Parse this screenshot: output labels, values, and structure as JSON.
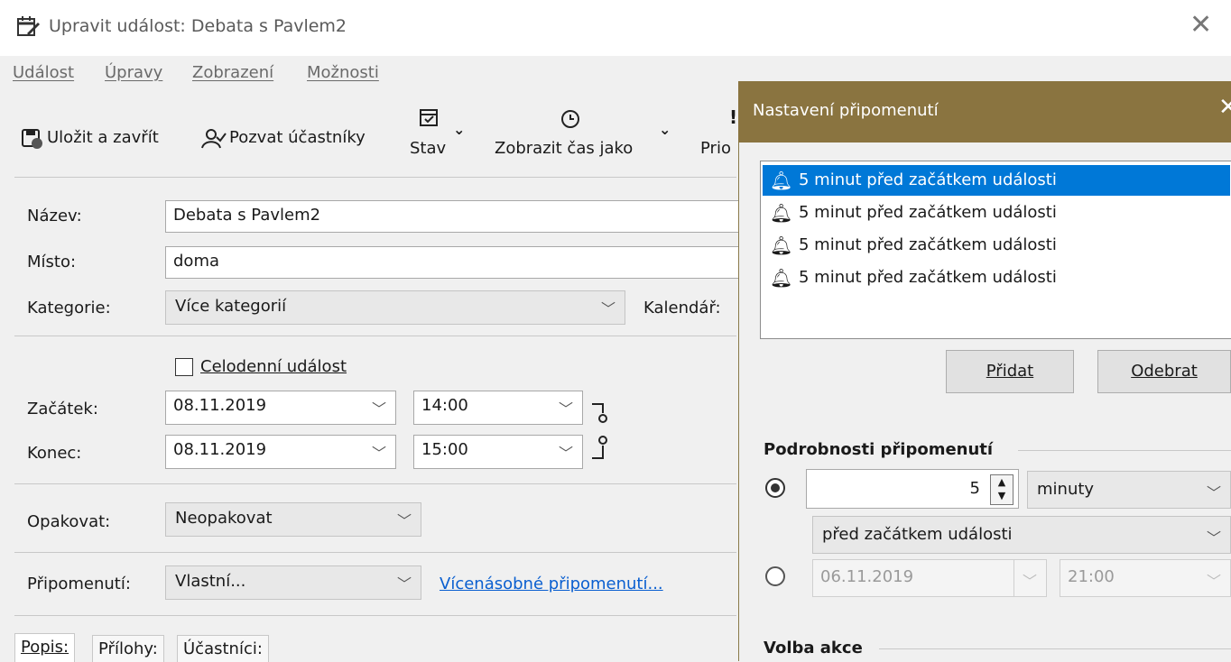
{
  "window": {
    "title": "Upravit událost: Debata s Pavlem2"
  },
  "menu": [
    "Událost",
    "Úpravy",
    "Zobrazení",
    "Možnosti"
  ],
  "toolbar": {
    "save_close": "Uložit a zavřít",
    "invite": "Pozvat účastníky",
    "status": "Stav",
    "show_time_as": "Zobrazit čas jako",
    "priority": "Prio"
  },
  "form": {
    "title_label": "Název:",
    "title_value": "Debata s Pavlem2",
    "location_label": "Místo:",
    "location_value": "doma",
    "category_label": "Kategorie:",
    "category_value": "Více kategorií",
    "calendar_label": "Kalendář:",
    "allday_label": "Celodenní událost",
    "start_label": "Začátek:",
    "start_date": "08.11.2019",
    "start_time": "14:00",
    "end_label": "Konec:",
    "end_date": "08.11.2019",
    "end_time": "15:00",
    "repeat_label": "Opakovat:",
    "repeat_value": "Neopakovat",
    "reminder_label": "Připomenutí:",
    "reminder_value": "Vlastní...",
    "multiple_reminders_link": "Vícenásobné připomenutí..."
  },
  "tabs": [
    "Popis:",
    "Přílohy:",
    "Účastníci:"
  ],
  "dialog": {
    "title": "Nastavení připomenutí",
    "reminders": [
      "5 minut před začátkem události",
      "5 minut před začátkem události",
      "5 minut před začátkem události",
      "5 minut před začátkem události"
    ],
    "add_button": "Přidat",
    "remove_button": "Odebrat",
    "details_title": "Podrobnosti připomenutí",
    "amount": "5",
    "unit": "minuty",
    "relation": "před začátkem události",
    "abs_date": "06.11.2019",
    "abs_time": "21:00",
    "action_title": "Volba akce"
  }
}
